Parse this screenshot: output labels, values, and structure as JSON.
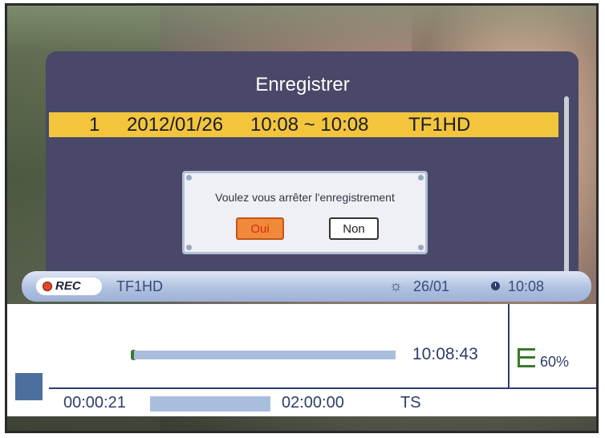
{
  "recordings": {
    "title": "Enregistrer",
    "selected_entry": {
      "index": "1",
      "date": "2012/01/26",
      "time_range": "10:08 ~ 10:08",
      "channel": "TF1HD"
    }
  },
  "dialog": {
    "question": "Voulez vous arrêter l'enregistrement",
    "yes_label": "Oui",
    "no_label": "Non",
    "yes_color": "#f08a3a"
  },
  "info_bar": {
    "rec_label": "REC",
    "channel": "TF1HD",
    "date": "26/01",
    "clock_time": "10:08",
    "icons": [
      "record-dot-icon",
      "sun-icon",
      "clock-icon"
    ]
  },
  "playback": {
    "current_time": "10:08:43",
    "signal_percent": "60%",
    "elapsed": "00:00:21",
    "total": "02:00:00",
    "format": "TS",
    "icons": [
      "signal-strength-icon"
    ]
  },
  "colors": {
    "highlight": "#f2c53d",
    "panel": "#4a4868",
    "accent": "#2e3e6a"
  }
}
